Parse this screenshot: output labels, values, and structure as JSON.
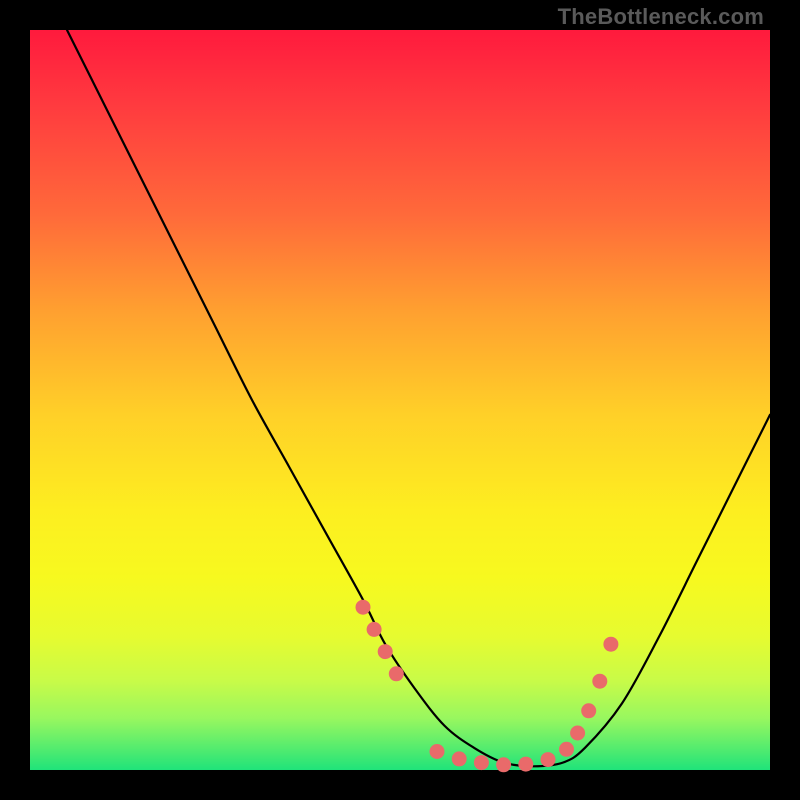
{
  "watermark": "TheBottleneck.com",
  "chart_data": {
    "type": "line",
    "title": "",
    "xlabel": "",
    "ylabel": "",
    "xlim": [
      0,
      100
    ],
    "ylim": [
      0,
      100
    ],
    "grid": false,
    "legend": false,
    "series": [
      {
        "name": "curve",
        "x": [
          5,
          10,
          15,
          20,
          25,
          30,
          35,
          40,
          45,
          48,
          52,
          56,
          60,
          64,
          68,
          72,
          75,
          80,
          85,
          90,
          95,
          100
        ],
        "y": [
          100,
          90,
          80,
          70,
          60,
          50,
          41,
          32,
          23,
          17,
          11,
          6,
          3,
          1,
          0.5,
          1,
          3,
          9,
          18,
          28,
          38,
          48
        ]
      }
    ],
    "markers": {
      "name": "highlight-dots",
      "color": "#e96a6a",
      "x": [
        45,
        46.5,
        48,
        49.5,
        55,
        58,
        61,
        64,
        67,
        70,
        72.5,
        74,
        75.5,
        77,
        78.5
      ],
      "y": [
        22,
        19,
        16,
        13,
        2.5,
        1.5,
        1,
        0.7,
        0.8,
        1.4,
        2.8,
        5,
        8,
        12,
        17
      ]
    },
    "background": {
      "type": "vertical-gradient",
      "stops": [
        {
          "pos": 0.0,
          "color": "#ff1a3d"
        },
        {
          "pos": 0.25,
          "color": "#ff6a3a"
        },
        {
          "pos": 0.52,
          "color": "#ffd028"
        },
        {
          "pos": 0.74,
          "color": "#f7f91f"
        },
        {
          "pos": 0.93,
          "color": "#98f75f"
        },
        {
          "pos": 1.0,
          "color": "#1fe37a"
        }
      ]
    }
  }
}
